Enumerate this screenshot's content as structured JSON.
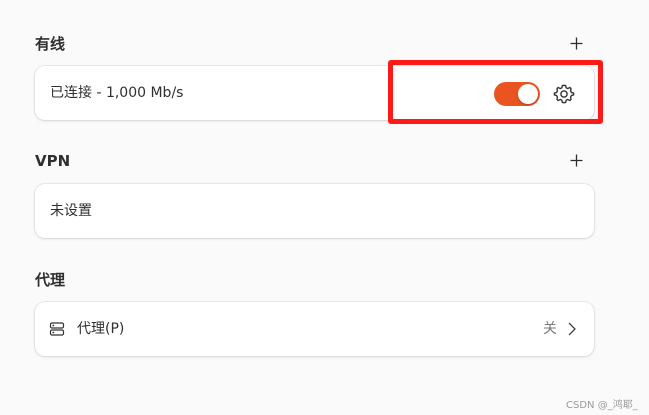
{
  "wired": {
    "title": "有线",
    "add_icon": "plus-icon",
    "status": "已连接 - 1,000 Mb/s",
    "toggle_on": true,
    "settings_icon": "gear-icon"
  },
  "vpn": {
    "title": "VPN",
    "add_icon": "plus-icon",
    "status": "未设置"
  },
  "proxy": {
    "title": "代理",
    "item_icon": "server-icon",
    "item_label": "代理(P)",
    "item_value": "关",
    "chevron_icon": "chevron-right-icon"
  },
  "watermark": "CSDN @_鸿耶_",
  "colors": {
    "accent": "#e95420",
    "highlight": "#ff1a1a"
  }
}
